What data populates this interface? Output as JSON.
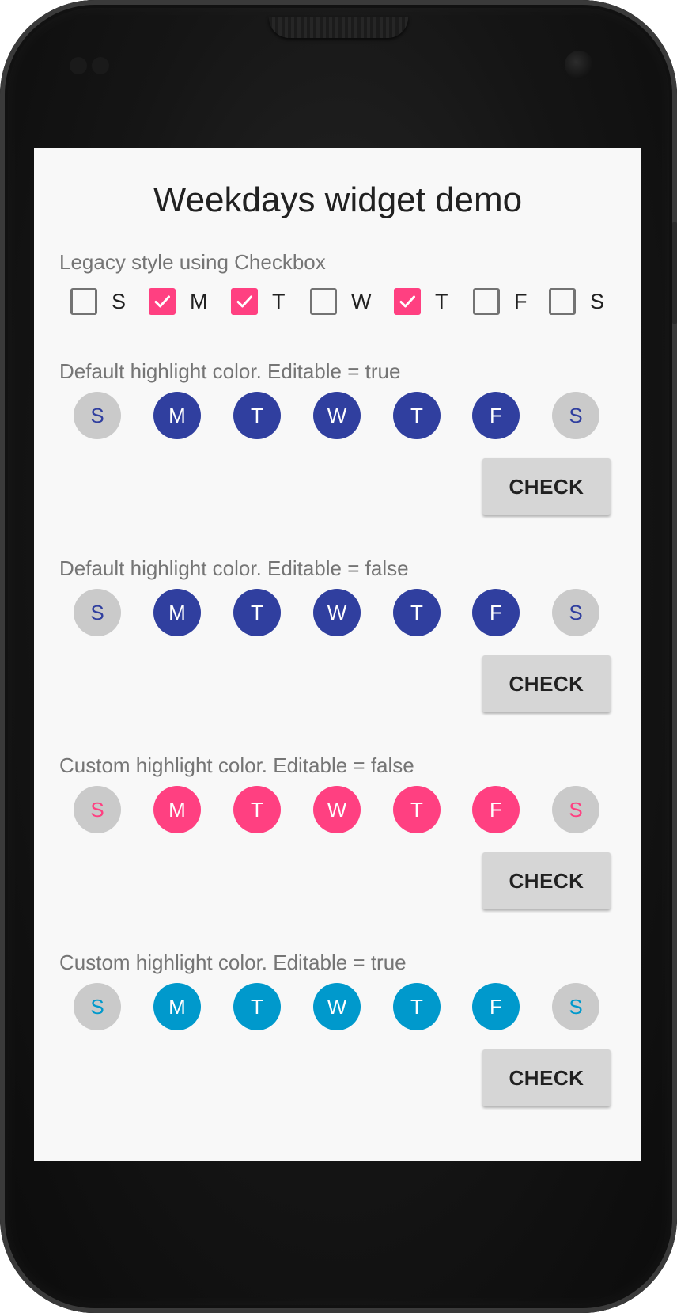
{
  "title": "Weekdays widget demo",
  "colors": {
    "accent_pink": "#ff4081",
    "indigo": "#303f9f",
    "cyan": "#0099cc",
    "unselected_circle": "#cacaca",
    "screen_bg": "#f8f8f8",
    "label_gray": "#757575"
  },
  "legacy": {
    "label": "Legacy style using Checkbox",
    "days": [
      {
        "letter": "S",
        "checked": false
      },
      {
        "letter": "M",
        "checked": true
      },
      {
        "letter": "T",
        "checked": true
      },
      {
        "letter": "W",
        "checked": false
      },
      {
        "letter": "T",
        "checked": true
      },
      {
        "letter": "F",
        "checked": false
      },
      {
        "letter": "S",
        "checked": false
      }
    ]
  },
  "sections": [
    {
      "label": "Default highlight color. Editable = true",
      "highlight": "#303f9f",
      "button_label": "CHECK",
      "days": [
        {
          "letter": "S",
          "selected": false
        },
        {
          "letter": "M",
          "selected": true
        },
        {
          "letter": "T",
          "selected": true
        },
        {
          "letter": "W",
          "selected": true
        },
        {
          "letter": "T",
          "selected": true
        },
        {
          "letter": "F",
          "selected": true
        },
        {
          "letter": "S",
          "selected": false
        }
      ]
    },
    {
      "label": "Default highlight color. Editable = false",
      "highlight": "#303f9f",
      "button_label": "CHECK",
      "days": [
        {
          "letter": "S",
          "selected": false
        },
        {
          "letter": "M",
          "selected": true
        },
        {
          "letter": "T",
          "selected": true
        },
        {
          "letter": "W",
          "selected": true
        },
        {
          "letter": "T",
          "selected": true
        },
        {
          "letter": "F",
          "selected": true
        },
        {
          "letter": "S",
          "selected": false
        }
      ]
    },
    {
      "label": "Custom highlight color. Editable = false",
      "highlight": "#ff4081",
      "button_label": "CHECK",
      "days": [
        {
          "letter": "S",
          "selected": false
        },
        {
          "letter": "M",
          "selected": true
        },
        {
          "letter": "T",
          "selected": true
        },
        {
          "letter": "W",
          "selected": true
        },
        {
          "letter": "T",
          "selected": true
        },
        {
          "letter": "F",
          "selected": true
        },
        {
          "letter": "S",
          "selected": false
        }
      ]
    },
    {
      "label": "Custom highlight color. Editable = true",
      "highlight": "#0099cc",
      "button_label": "CHECK",
      "days": [
        {
          "letter": "S",
          "selected": false
        },
        {
          "letter": "M",
          "selected": true
        },
        {
          "letter": "T",
          "selected": true
        },
        {
          "letter": "W",
          "selected": true
        },
        {
          "letter": "T",
          "selected": true
        },
        {
          "letter": "F",
          "selected": true
        },
        {
          "letter": "S",
          "selected": false
        }
      ]
    }
  ]
}
